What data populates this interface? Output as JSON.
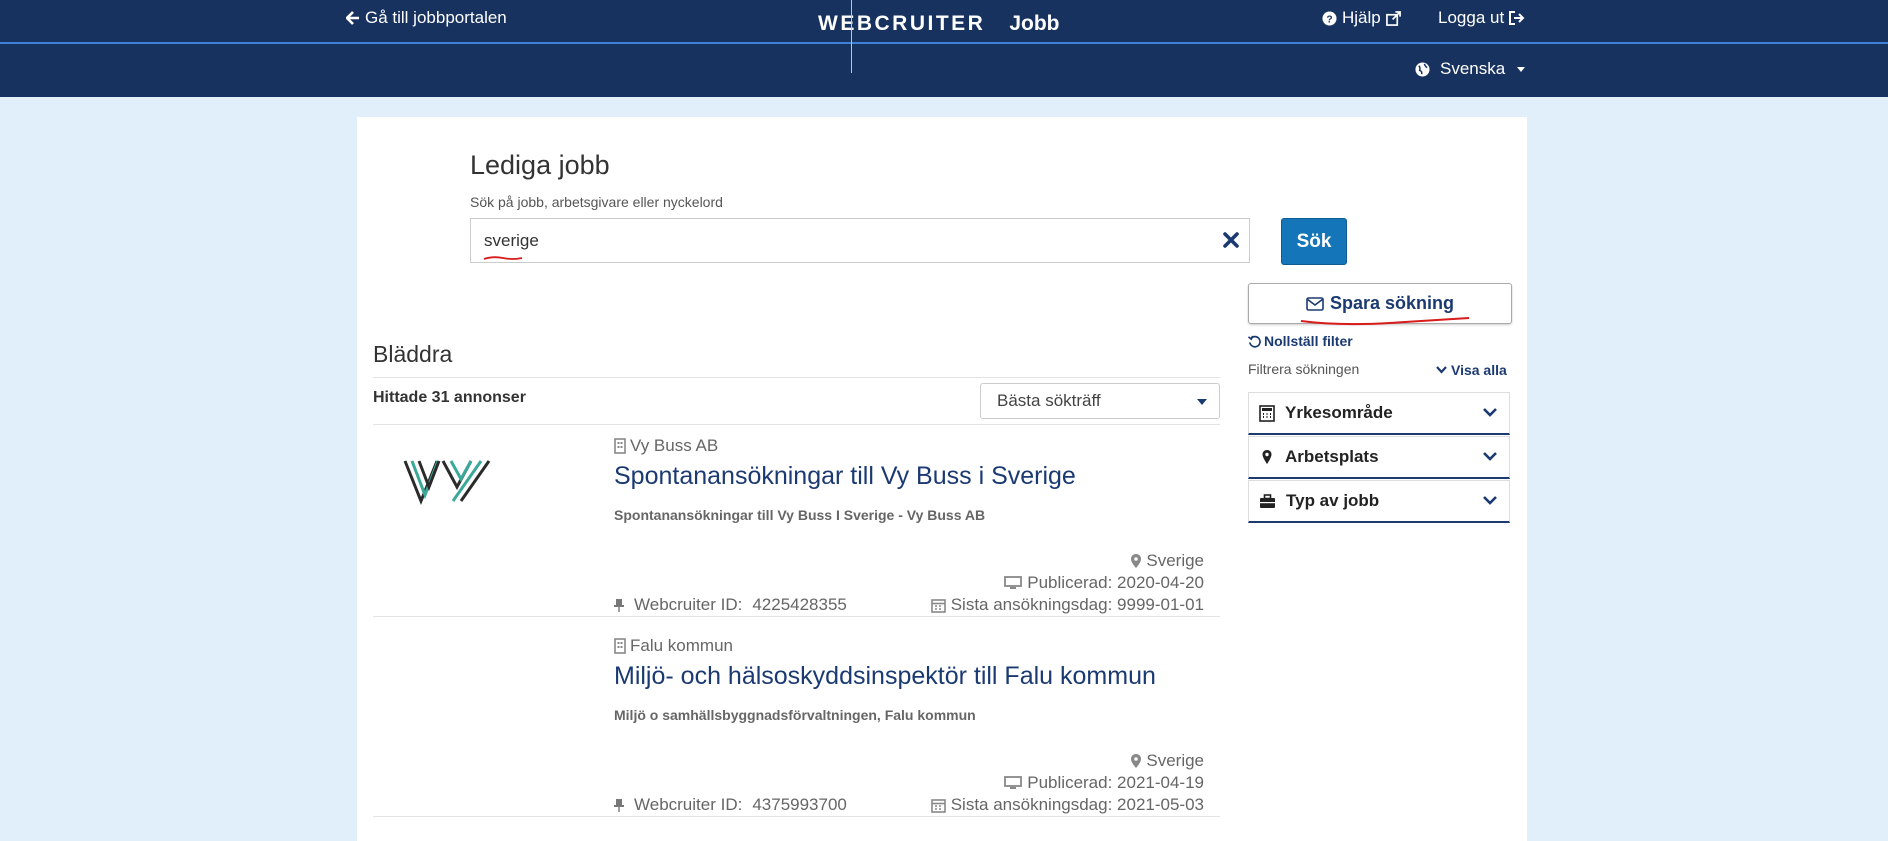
{
  "header": {
    "portal_link": "Gå till jobbportalen",
    "brand_name": "WEBCRUITER",
    "brand_sub": "Jobb",
    "help": "Hjälp",
    "logout": "Logga ut",
    "language": "Svenska"
  },
  "search": {
    "title": "Lediga jobb",
    "hint": "Sök på jobb, arbetsgivare eller nyckelord",
    "value": "sverige",
    "button": "Sök",
    "save_button": "Spara sökning"
  },
  "browse": {
    "title": "Bläddra",
    "found": "Hittade 31 annonser",
    "sort": "Bästa sökträff"
  },
  "jobs": [
    {
      "employer": "Vy Buss AB",
      "title": "Spontanansökningar till Vy Buss i Sverige",
      "subtitle": "Spontanansökningar till Vy Buss I Sverige - Vy Buss AB",
      "location": "Sverige",
      "published": "Publicerad: 2020-04-20",
      "deadline": "Sista ansökningsdag: 9999-01-01",
      "id_label": "Webcruiter ID:",
      "id": "4225428355"
    },
    {
      "employer": "Falu kommun",
      "title": "Miljö- och hälsoskyddsinspektör till Falu kommun",
      "subtitle": "Miljö o samhällsbyggnadsförvaltningen, Falu kommun",
      "location": "Sverige",
      "published": "Publicerad: 2021-04-19",
      "deadline": "Sista ansökningsdag: 2021-05-03",
      "id_label": "Webcruiter ID:",
      "id": "4375993700"
    }
  ],
  "filters": {
    "reset": "Nollställ filter",
    "label": "Filtrera sökningen",
    "show_all": "Visa alla",
    "groups": [
      {
        "label": "Yrkesområde",
        "icon": "calculator-icon"
      },
      {
        "label": "Arbetsplats",
        "icon": "map-marker-icon"
      },
      {
        "label": "Typ av jobb",
        "icon": "briefcase-icon"
      }
    ]
  },
  "colors": {
    "header_bg": "#17325f",
    "accent_blue": "#1476b8",
    "link_navy": "#1b3a72",
    "page_bg": "#e1effb"
  }
}
